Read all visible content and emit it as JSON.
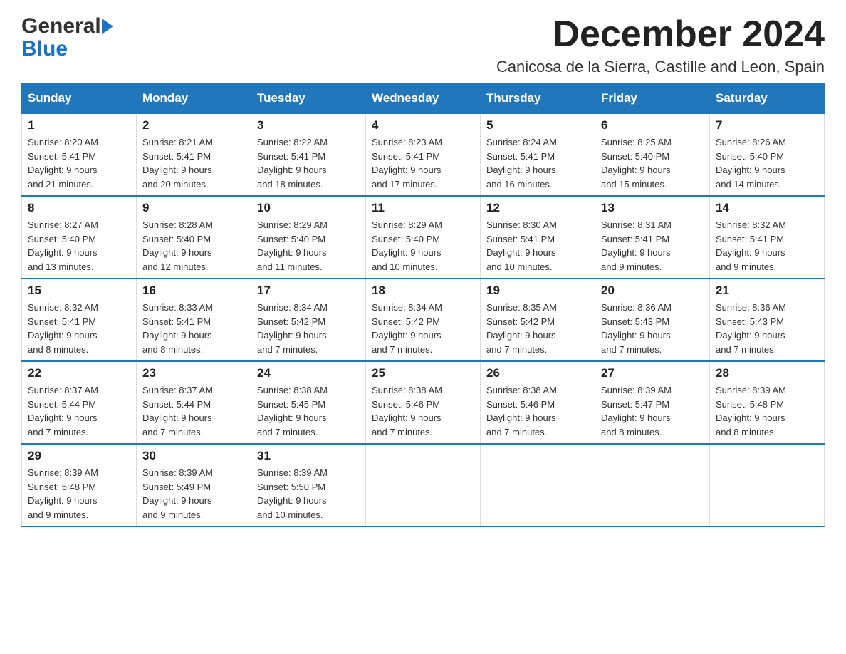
{
  "header": {
    "logo_general": "General",
    "logo_blue": "Blue",
    "month_title": "December 2024",
    "subtitle": "Canicosa de la Sierra, Castille and Leon, Spain"
  },
  "days_of_week": [
    "Sunday",
    "Monday",
    "Tuesday",
    "Wednesday",
    "Thursday",
    "Friday",
    "Saturday"
  ],
  "weeks": [
    [
      {
        "day": "1",
        "sunrise": "8:20 AM",
        "sunset": "5:41 PM",
        "daylight": "9 hours and 21 minutes."
      },
      {
        "day": "2",
        "sunrise": "8:21 AM",
        "sunset": "5:41 PM",
        "daylight": "9 hours and 20 minutes."
      },
      {
        "day": "3",
        "sunrise": "8:22 AM",
        "sunset": "5:41 PM",
        "daylight": "9 hours and 18 minutes."
      },
      {
        "day": "4",
        "sunrise": "8:23 AM",
        "sunset": "5:41 PM",
        "daylight": "9 hours and 17 minutes."
      },
      {
        "day": "5",
        "sunrise": "8:24 AM",
        "sunset": "5:41 PM",
        "daylight": "9 hours and 16 minutes."
      },
      {
        "day": "6",
        "sunrise": "8:25 AM",
        "sunset": "5:40 PM",
        "daylight": "9 hours and 15 minutes."
      },
      {
        "day": "7",
        "sunrise": "8:26 AM",
        "sunset": "5:40 PM",
        "daylight": "9 hours and 14 minutes."
      }
    ],
    [
      {
        "day": "8",
        "sunrise": "8:27 AM",
        "sunset": "5:40 PM",
        "daylight": "9 hours and 13 minutes."
      },
      {
        "day": "9",
        "sunrise": "8:28 AM",
        "sunset": "5:40 PM",
        "daylight": "9 hours and 12 minutes."
      },
      {
        "day": "10",
        "sunrise": "8:29 AM",
        "sunset": "5:40 PM",
        "daylight": "9 hours and 11 minutes."
      },
      {
        "day": "11",
        "sunrise": "8:29 AM",
        "sunset": "5:40 PM",
        "daylight": "9 hours and 10 minutes."
      },
      {
        "day": "12",
        "sunrise": "8:30 AM",
        "sunset": "5:41 PM",
        "daylight": "9 hours and 10 minutes."
      },
      {
        "day": "13",
        "sunrise": "8:31 AM",
        "sunset": "5:41 PM",
        "daylight": "9 hours and 9 minutes."
      },
      {
        "day": "14",
        "sunrise": "8:32 AM",
        "sunset": "5:41 PM",
        "daylight": "9 hours and 9 minutes."
      }
    ],
    [
      {
        "day": "15",
        "sunrise": "8:32 AM",
        "sunset": "5:41 PM",
        "daylight": "9 hours and 8 minutes."
      },
      {
        "day": "16",
        "sunrise": "8:33 AM",
        "sunset": "5:41 PM",
        "daylight": "9 hours and 8 minutes."
      },
      {
        "day": "17",
        "sunrise": "8:34 AM",
        "sunset": "5:42 PM",
        "daylight": "9 hours and 7 minutes."
      },
      {
        "day": "18",
        "sunrise": "8:34 AM",
        "sunset": "5:42 PM",
        "daylight": "9 hours and 7 minutes."
      },
      {
        "day": "19",
        "sunrise": "8:35 AM",
        "sunset": "5:42 PM",
        "daylight": "9 hours and 7 minutes."
      },
      {
        "day": "20",
        "sunrise": "8:36 AM",
        "sunset": "5:43 PM",
        "daylight": "9 hours and 7 minutes."
      },
      {
        "day": "21",
        "sunrise": "8:36 AM",
        "sunset": "5:43 PM",
        "daylight": "9 hours and 7 minutes."
      }
    ],
    [
      {
        "day": "22",
        "sunrise": "8:37 AM",
        "sunset": "5:44 PM",
        "daylight": "9 hours and 7 minutes."
      },
      {
        "day": "23",
        "sunrise": "8:37 AM",
        "sunset": "5:44 PM",
        "daylight": "9 hours and 7 minutes."
      },
      {
        "day": "24",
        "sunrise": "8:38 AM",
        "sunset": "5:45 PM",
        "daylight": "9 hours and 7 minutes."
      },
      {
        "day": "25",
        "sunrise": "8:38 AM",
        "sunset": "5:46 PM",
        "daylight": "9 hours and 7 minutes."
      },
      {
        "day": "26",
        "sunrise": "8:38 AM",
        "sunset": "5:46 PM",
        "daylight": "9 hours and 7 minutes."
      },
      {
        "day": "27",
        "sunrise": "8:39 AM",
        "sunset": "5:47 PM",
        "daylight": "9 hours and 8 minutes."
      },
      {
        "day": "28",
        "sunrise": "8:39 AM",
        "sunset": "5:48 PM",
        "daylight": "9 hours and 8 minutes."
      }
    ],
    [
      {
        "day": "29",
        "sunrise": "8:39 AM",
        "sunset": "5:48 PM",
        "daylight": "9 hours and 9 minutes."
      },
      {
        "day": "30",
        "sunrise": "8:39 AM",
        "sunset": "5:49 PM",
        "daylight": "9 hours and 9 minutes."
      },
      {
        "day": "31",
        "sunrise": "8:39 AM",
        "sunset": "5:50 PM",
        "daylight": "9 hours and 10 minutes."
      },
      null,
      null,
      null,
      null
    ]
  ],
  "labels": {
    "sunrise_prefix": "Sunrise: ",
    "sunset_prefix": "Sunset: ",
    "daylight_prefix": "Daylight: "
  },
  "colors": {
    "header_bg": "#2277bb",
    "header_text": "#ffffff",
    "accent": "#1a73c7"
  }
}
